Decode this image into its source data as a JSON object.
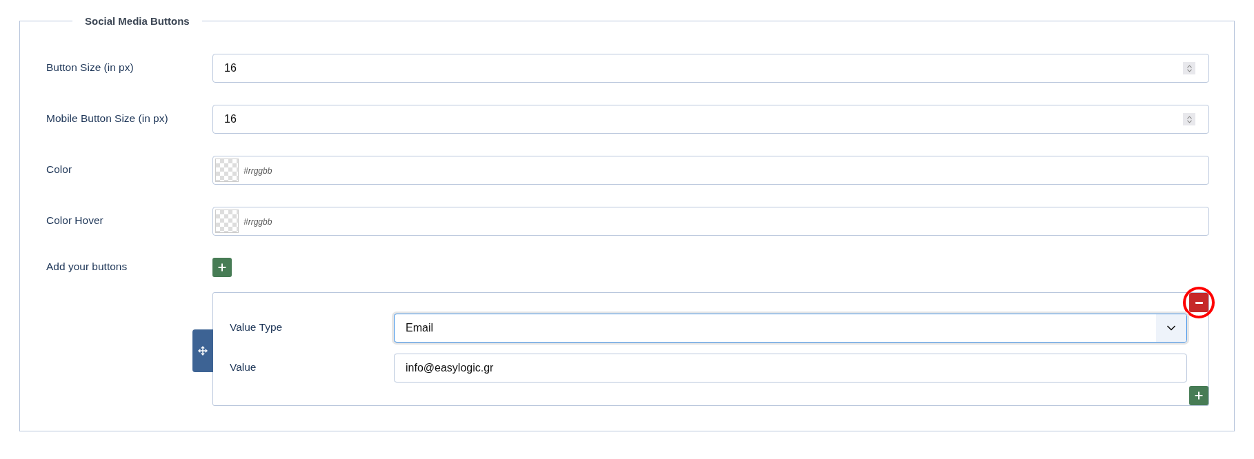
{
  "fieldset": {
    "legend": "Social Media Buttons"
  },
  "fields": [
    {
      "kind": "number",
      "label": "Button Size (in px)",
      "value": "16"
    },
    {
      "kind": "number",
      "label": "Mobile Button Size (in px)",
      "value": "16"
    },
    {
      "kind": "color",
      "label": "Color",
      "placeholder": "#rrggbb"
    },
    {
      "kind": "color",
      "label": "Color Hover",
      "placeholder": "#rrggbb"
    }
  ],
  "repeatable": {
    "label": "Add your buttons",
    "items": [
      {
        "highlighted": true,
        "fields": [
          {
            "kind": "select",
            "label": "Value Type",
            "value": "Email",
            "focused": true
          },
          {
            "kind": "text",
            "label": "Value",
            "value": "info@easylogic.gr",
            "focused": false
          }
        ]
      }
    ]
  }
}
